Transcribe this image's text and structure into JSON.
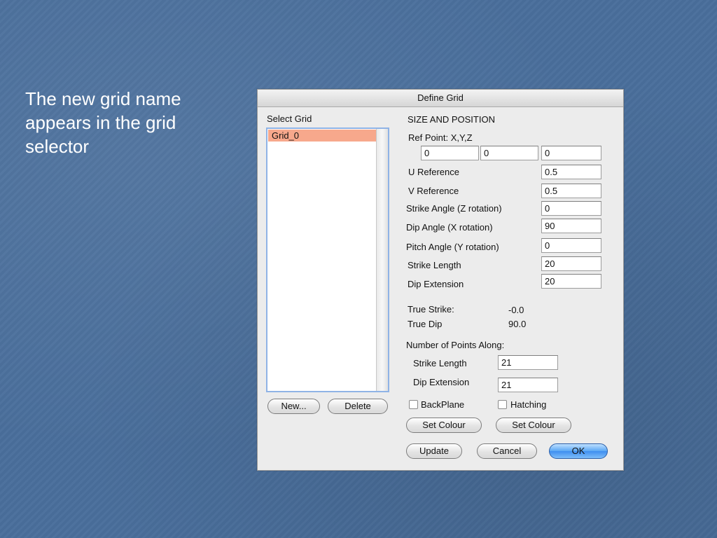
{
  "slide": {
    "text": "The new grid name\nappears in the grid\nselector"
  },
  "dialog": {
    "title": "Define Grid",
    "select_grid": {
      "label": "Select Grid",
      "items": [
        "Grid_0"
      ],
      "new_button": "New...",
      "delete_button": "Delete"
    },
    "size_position": {
      "heading": "SIZE AND POSITION",
      "ref_point_label": "Ref Point: X,Y,Z",
      "ref_x": "0",
      "ref_y": "0",
      "ref_z": "0",
      "u_reference_label": "U Reference",
      "u_reference": "0.5",
      "v_reference_label": "V Reference",
      "v_reference": "0.5",
      "strike_angle_label": "Strike Angle (Z rotation)",
      "strike_angle": "0",
      "dip_angle_label": "Dip Angle (X rotation)",
      "dip_angle": "90",
      "pitch_angle_label": "Pitch Angle (Y rotation)",
      "pitch_angle": "0",
      "strike_length_label": "Strike Length",
      "strike_length": "20",
      "dip_extension_label": "Dip Extension",
      "dip_extension": "20"
    },
    "true_values": {
      "true_strike_label": "True Strike:",
      "true_strike": "-0.0",
      "true_dip_label": "True Dip",
      "true_dip": "90.0"
    },
    "points": {
      "heading": "Number of  Points Along:",
      "strike_length_label": "Strike Length",
      "strike_length": "21",
      "dip_extension_label": "Dip Extension",
      "dip_extension": "21"
    },
    "options": {
      "backplane_label": "BackPlane",
      "backplane_checked": false,
      "hatching_label": "Hatching",
      "hatching_checked": false,
      "set_colour_1": "Set Colour",
      "set_colour_2": "Set Colour"
    },
    "actions": {
      "update": "Update",
      "cancel": "Cancel",
      "ok": "OK"
    }
  }
}
